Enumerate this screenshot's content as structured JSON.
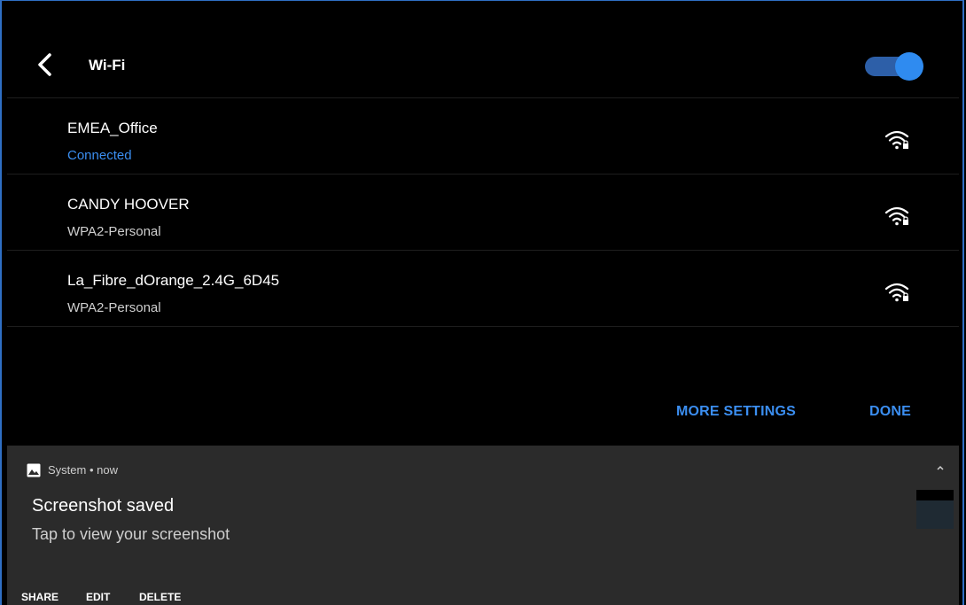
{
  "header": {
    "title": "Wi-Fi",
    "toggle_on": true
  },
  "networks": [
    {
      "name": "EMEA_Office",
      "status": "Connected",
      "connected": true,
      "icon": "wifi-lock-icon"
    },
    {
      "name": "CANDY HOOVER",
      "status": "WPA2-Personal",
      "connected": false,
      "icon": "wifi-lock-icon"
    },
    {
      "name": "La_Fibre_dOrange_2.4G_6D45",
      "status": "WPA2-Personal",
      "connected": false,
      "icon": "wifi-lock-icon"
    }
  ],
  "actions": {
    "more_settings": "MORE SETTINGS",
    "done": "DONE"
  },
  "notification": {
    "app": "System • now",
    "title": "Screenshot saved",
    "text": "Tap to view your screenshot",
    "buttons": {
      "share": "SHARE",
      "edit": "EDIT",
      "delete": "DELETE"
    }
  },
  "colors": {
    "accent": "#3b8ef0",
    "toggle_track": "#2d5fa8",
    "toggle_thumb": "#2f8bf0",
    "notification_bg": "#2b2b2b"
  }
}
